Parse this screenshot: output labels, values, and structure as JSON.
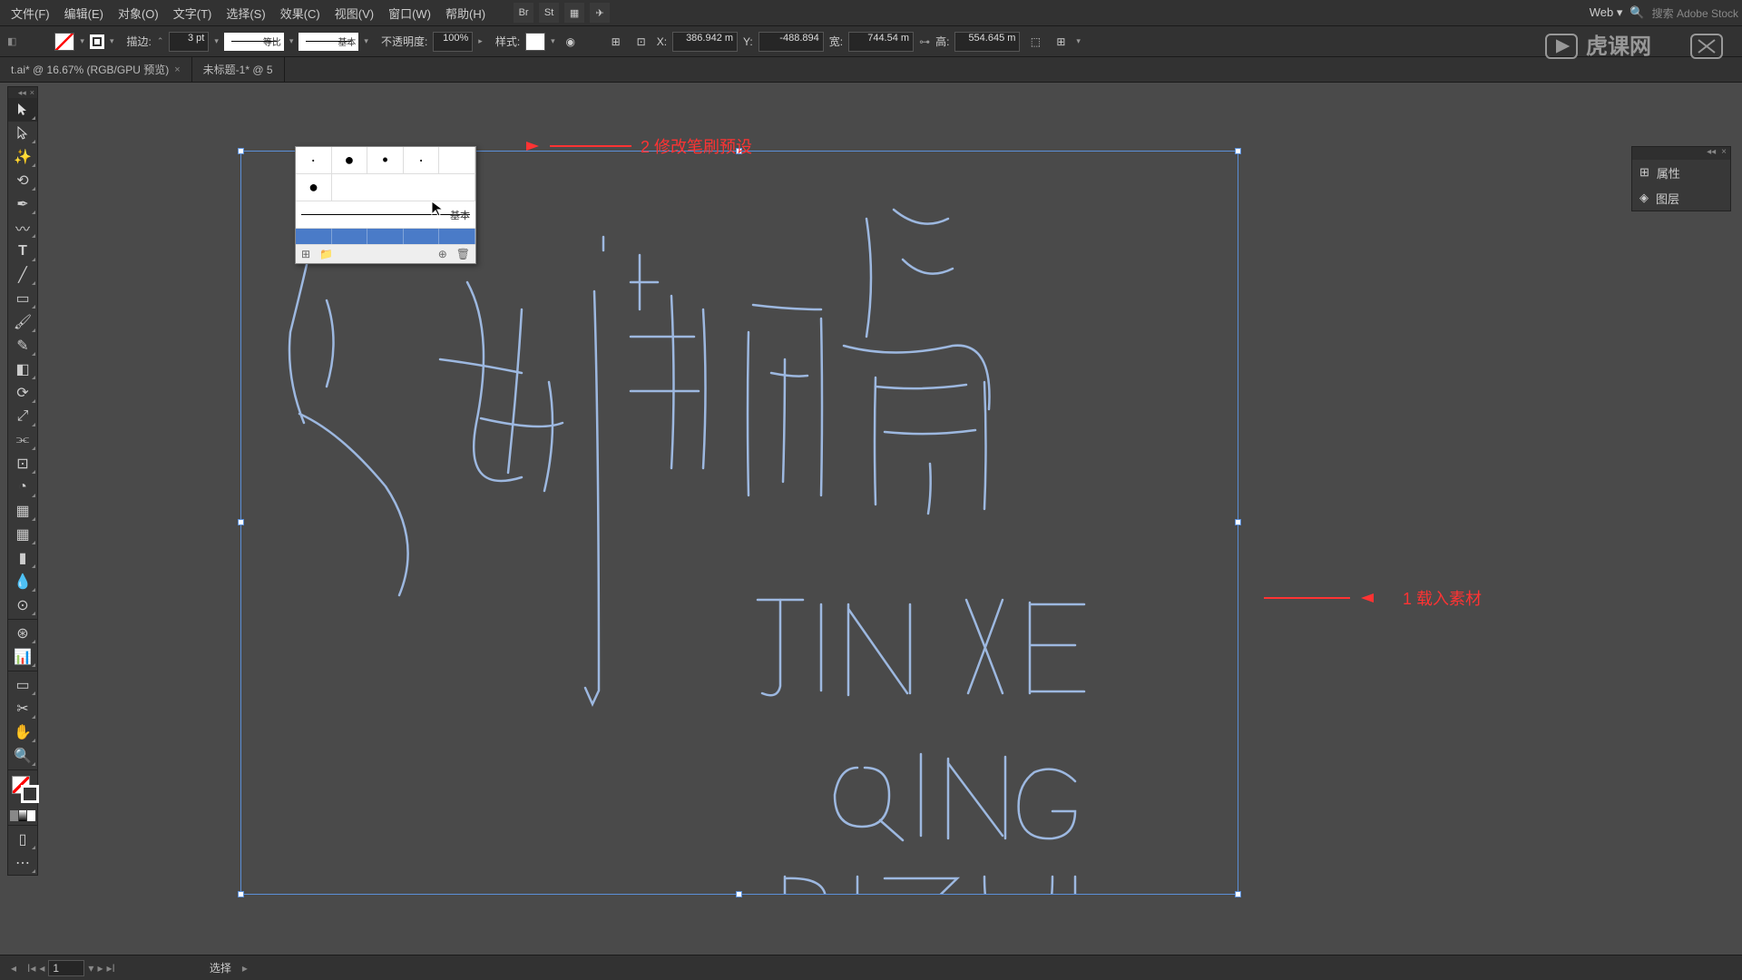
{
  "menu": {
    "file": "文件(F)",
    "edit": "编辑(E)",
    "object": "对象(O)",
    "type": "文字(T)",
    "select": "选择(S)",
    "effect": "效果(C)",
    "view": "视图(V)",
    "window": "窗口(W)",
    "help": "帮助(H)",
    "workspace": "Web",
    "search": "搜索 Adobe Stock"
  },
  "opt": {
    "stroke_lbl": "描边:",
    "stroke_val": "3 pt",
    "prop_txt": "等比",
    "basic_txt": "基本",
    "opacity_lbl": "不透明度:",
    "opacity_val": "100%",
    "style_lbl": "样式:",
    "x_lbl": "X:",
    "x_val": "386.942 m",
    "y_lbl": "Y:",
    "y_val": "-488.894",
    "w_lbl": "宽:",
    "w_val": "744.54 m",
    "h_lbl": "高:",
    "h_val": "554.645 m"
  },
  "tabs": {
    "t1": "t.ai* @ 16.67% (RGB/GPU 预览)",
    "t2": "未标题-1* @ 5"
  },
  "brushpanel": {
    "basic": "基本"
  },
  "anno": {
    "a1": "1 载入素材",
    "a2": "2 修改笔刷预设"
  },
  "rpanel": {
    "p1": "属性",
    "p2": "图层"
  },
  "status": {
    "page": "1",
    "mode": "选择"
  }
}
